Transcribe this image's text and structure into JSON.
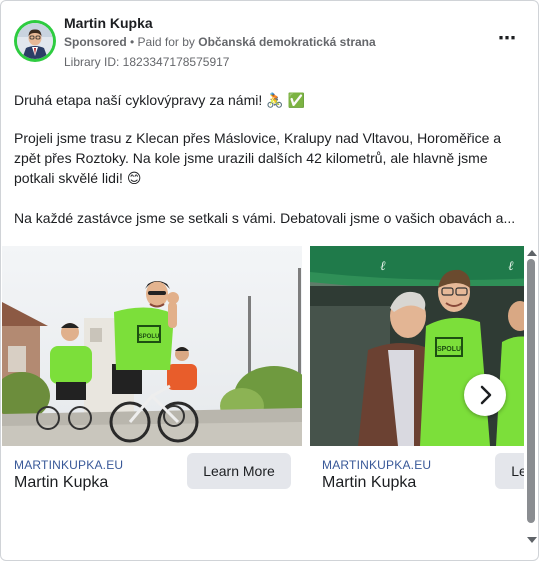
{
  "header": {
    "name": "Martin Kupka",
    "sponsored": "Sponsored",
    "paid_by_prefix": " • Paid for by ",
    "payer": "Občanská demokratická strana",
    "library_id": "Library ID: 1823347178575917",
    "more_icon": "⋯"
  },
  "post": {
    "line1": "Druhá etapa naší cyklovýpravy za námi! 🚴 ✅",
    "line2": "Projeli jsme trasu z Klecan přes Máslovice, Kralupy nad Vltavou, Horoměřice a zpět přes Roztoky. Na kole jsme urazili dalších 42 kilometrů, ale hlavně jsme potkali skvělé lidi! 😊",
    "line3": "Na každé zastávce jsme se setkali s vámi. Debatovali jsme o vašich obavách a..."
  },
  "carousel": {
    "cards": [
      {
        "domain": "MARTINKUPKA.EU",
        "title": "Martin Kupka",
        "cta": "Learn More",
        "shirt_text": "SPOLU"
      },
      {
        "domain": "MARTINKUPKA.EU",
        "title": "Martin Kupka",
        "cta": "Learn More",
        "shirt_text": "SPOLU"
      }
    ],
    "next_icon": "chevron-right-icon"
  },
  "colors": {
    "avatar_ring": "#2ecc40",
    "shirt_green": "#7cdf3a",
    "link_blue": "#385898",
    "button_gray": "#e4e6eb"
  }
}
